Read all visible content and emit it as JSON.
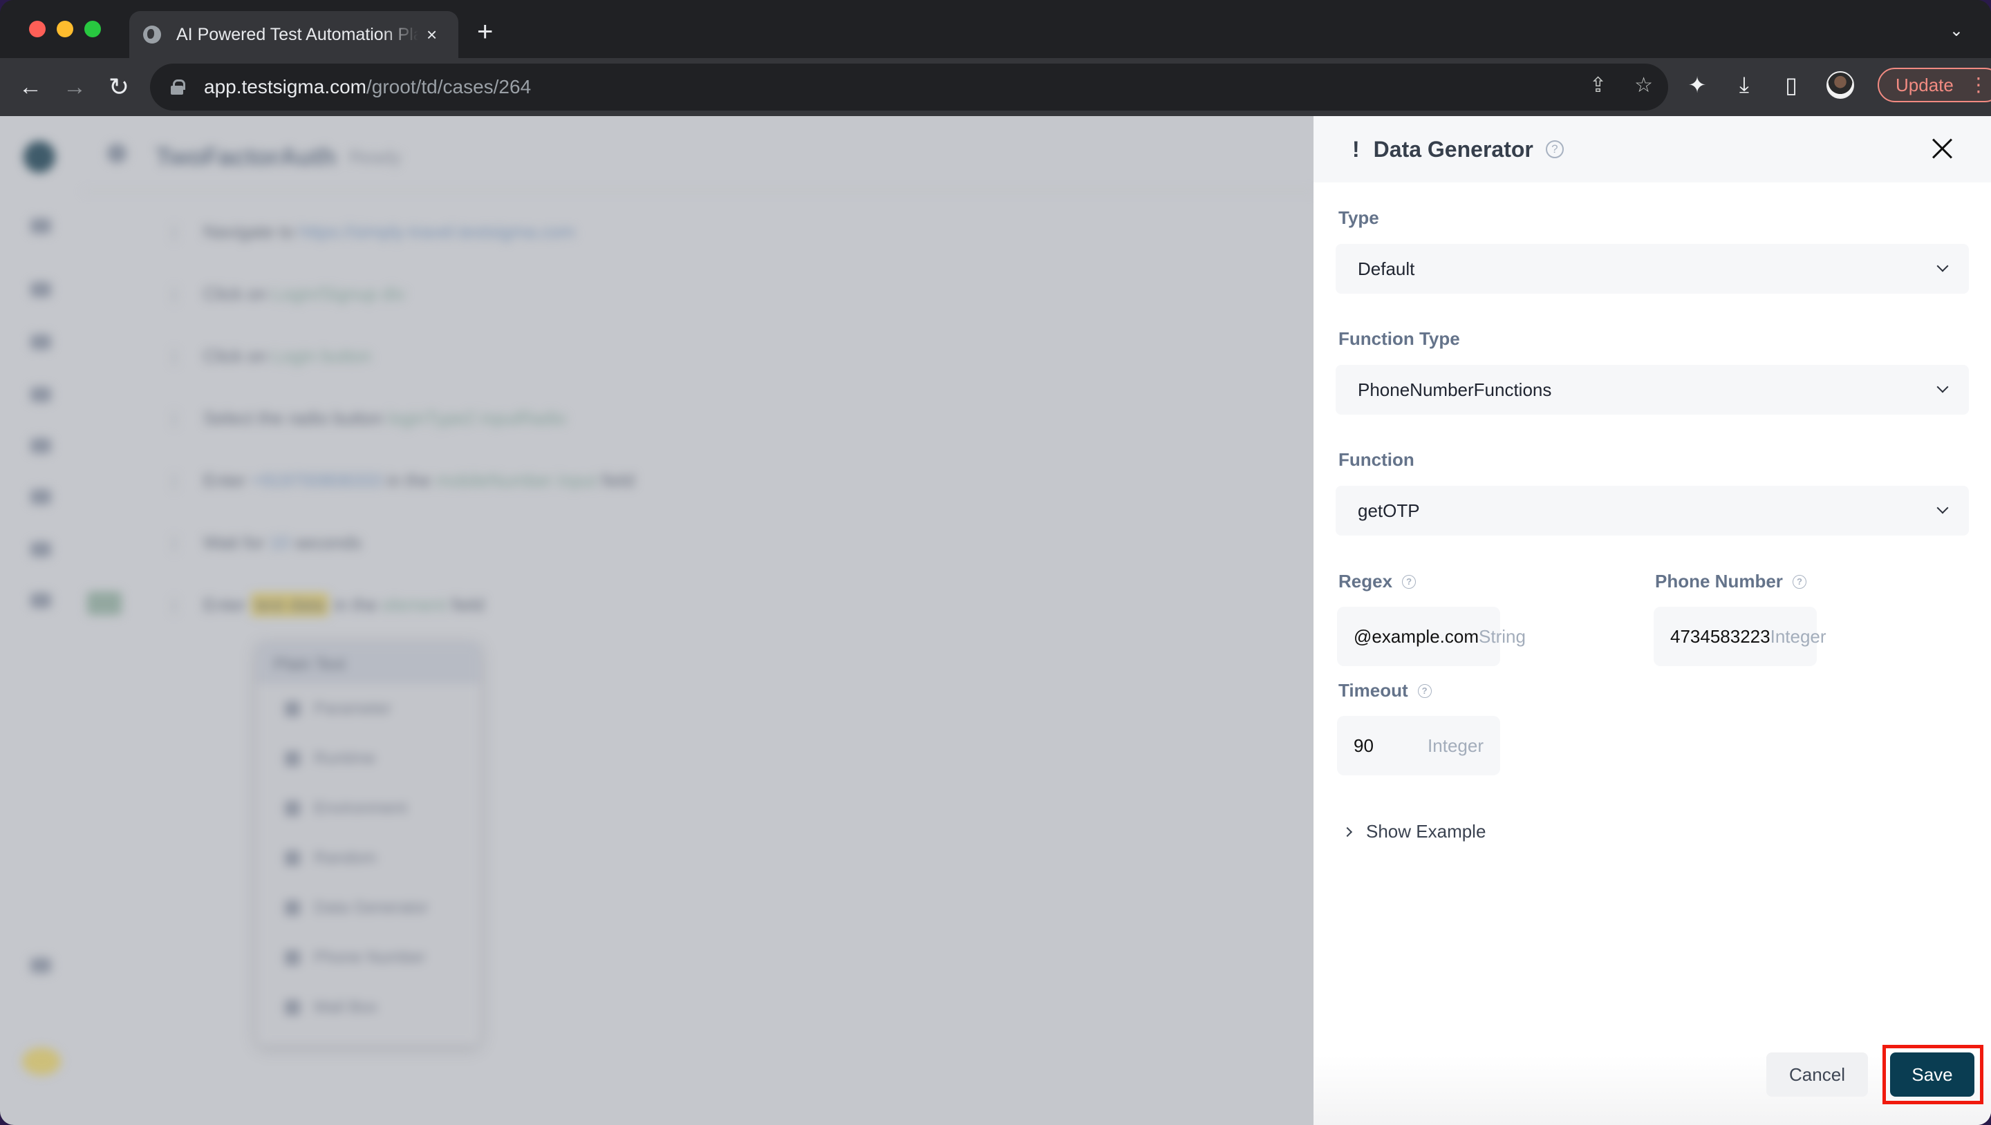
{
  "browser": {
    "tab_title": "AI Powered Test Automation Platform",
    "url_host": "app.testsigma.com",
    "url_path": "/groot/td/cases/264",
    "update_label": "Update",
    "new_tab_label": "+",
    "tab_close_label": "×",
    "tab_search_label": "⌄"
  },
  "background": {
    "title": "TwoFactorAuth",
    "badge": "Ready",
    "steps": [
      {
        "prefix": "Navigate to",
        "value": "https://simply-travel.testsigma.com",
        "suffix": ""
      },
      {
        "prefix": "Click on",
        "value": "Login/Signup div",
        "suffix": ""
      },
      {
        "prefix": "Click on",
        "value": "Login button",
        "suffix": ""
      },
      {
        "prefix": "Select the radio button",
        "value": "loginType2 inputRadio",
        "suffix": ""
      },
      {
        "prefix": "Enter",
        "value": "+919700808333",
        "mid": "in the",
        "value2": "mobileNumber input",
        "suffix": "field"
      },
      {
        "prefix": "Wait for",
        "value": "10",
        "suffix": "seconds"
      },
      {
        "prefix": "Enter",
        "value": "test data",
        "mid": "in the",
        "value2": "element",
        "suffix": "field"
      }
    ],
    "dropdown": {
      "header": "Plain Text",
      "items": [
        "Parameter",
        "Runtime",
        "Environment",
        "Random",
        "Data Generator",
        "Phone Number",
        "Mail Box"
      ]
    }
  },
  "panel": {
    "title_prefix": "!",
    "title": "Data Generator",
    "help": "?",
    "fields": {
      "type": {
        "label": "Type",
        "value": "Default"
      },
      "function_type": {
        "label": "Function Type",
        "value": "PhoneNumberFunctions"
      },
      "function": {
        "label": "Function",
        "value": "getOTP"
      },
      "regex": {
        "label": "Regex",
        "value": "@example.com",
        "data_type": "String"
      },
      "phone_number": {
        "label": "Phone Number",
        "value": "4734583223",
        "data_type": "Integer"
      },
      "timeout": {
        "label": "Timeout",
        "value": "90",
        "data_type": "Integer"
      }
    },
    "show_example_label": "Show Example",
    "cancel_label": "Cancel",
    "save_label": "Save"
  },
  "colors": {
    "save_button": "#0a3d52",
    "highlight_box": "#f01a0e",
    "update_accent": "#f28b82"
  }
}
